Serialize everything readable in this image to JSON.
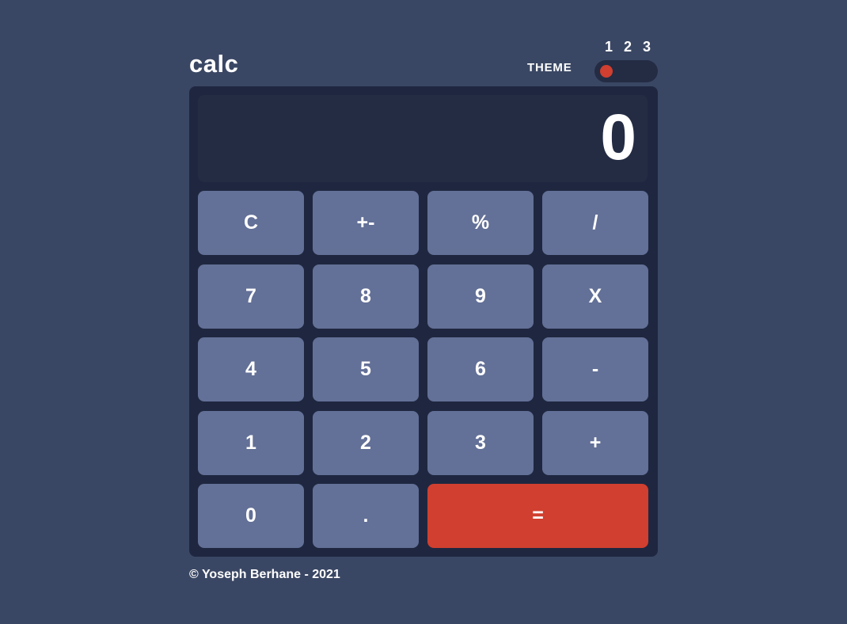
{
  "header": {
    "logo": "calc",
    "theme_label": "THEME",
    "theme_numbers": [
      "1",
      "2",
      "3"
    ],
    "active_theme": 1
  },
  "display": {
    "value": "0"
  },
  "keys": [
    {
      "label": "C",
      "type": "function"
    },
    {
      "label": "+-",
      "type": "function"
    },
    {
      "label": "%",
      "type": "function"
    },
    {
      "label": "/",
      "type": "operator"
    },
    {
      "label": "7",
      "type": "digit"
    },
    {
      "label": "8",
      "type": "digit"
    },
    {
      "label": "9",
      "type": "digit"
    },
    {
      "label": "X",
      "type": "operator"
    },
    {
      "label": "4",
      "type": "digit"
    },
    {
      "label": "5",
      "type": "digit"
    },
    {
      "label": "6",
      "type": "digit"
    },
    {
      "label": "-",
      "type": "operator"
    },
    {
      "label": "1",
      "type": "digit"
    },
    {
      "label": "2",
      "type": "digit"
    },
    {
      "label": "3",
      "type": "digit"
    },
    {
      "label": "+",
      "type": "operator"
    },
    {
      "label": "0",
      "type": "digit"
    },
    {
      "label": ".",
      "type": "digit"
    },
    {
      "label": "=",
      "type": "equals"
    }
  ],
  "footer": {
    "text": "© Yoseph Berhane - 2021"
  },
  "colors": {
    "background": "#3a4764",
    "keypad_background": "#1f2740",
    "screen_background": "#232c43",
    "key": "#637097",
    "accent": "#d03f2f",
    "text": "#ffffff"
  }
}
